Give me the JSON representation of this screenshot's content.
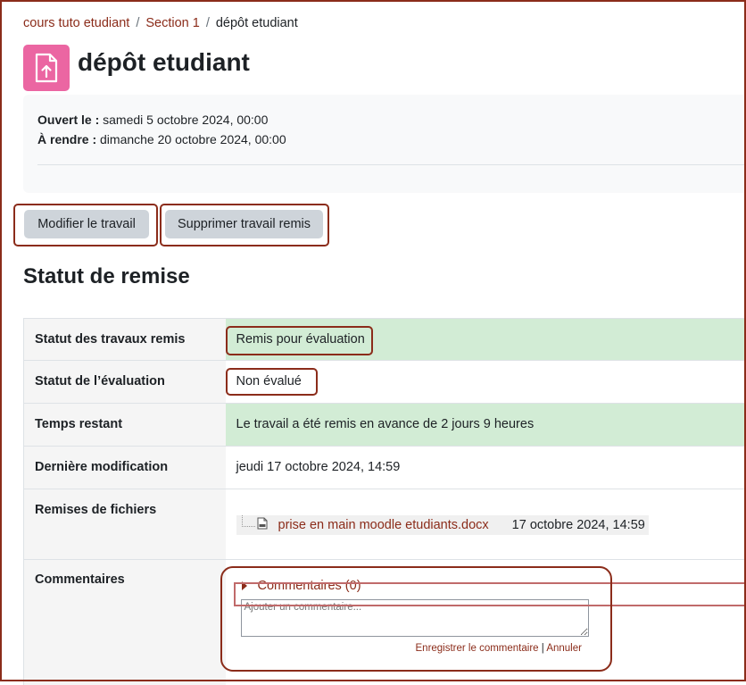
{
  "breadcrumb": {
    "items": [
      "cours tuto etudiant",
      "Section 1"
    ],
    "separator": "/",
    "current": "dépôt etudiant"
  },
  "page": {
    "title": "dépôt etudiant",
    "icon": "file-upload-icon",
    "accent_color": "#eb66a2"
  },
  "dates": {
    "opened_label": "Ouvert le :",
    "opened_value": "samedi 5 octobre 2024, 00:00",
    "due_label": "À rendre :",
    "due_value": "dimanche 20 octobre 2024, 00:00"
  },
  "actions": {
    "edit_label": "Modifier le travail",
    "delete_label": "Supprimer travail remis"
  },
  "submission_status": {
    "heading": "Statut de remise",
    "rows": [
      {
        "label": "Statut des travaux remis",
        "value": "Remis pour évaluation"
      },
      {
        "label": "Statut de l’évaluation",
        "value": "Non évalué"
      },
      {
        "label": "Temps restant",
        "value": "Le travail a été remis en avance de 2 jours 9 heures"
      },
      {
        "label": "Dernière modification",
        "value": "jeudi 17 octobre 2024, 14:59"
      },
      {
        "label": "Remises de fichiers",
        "file_name": "prise en main moodle etudiants.docx",
        "file_date": "17 octobre 2024, 14:59"
      },
      {
        "label": "Commentaires",
        "toggle": "Commentaires (0)",
        "placeholder": "Ajouter un commentaire...",
        "save_label": "Enregistrer le commentaire",
        "divider": "|",
        "cancel_label": "Annuler"
      }
    ]
  },
  "colors": {
    "link": "#8b2c1a",
    "success_bg": "#d2ecd5",
    "annotation": "#8b2c1a"
  }
}
